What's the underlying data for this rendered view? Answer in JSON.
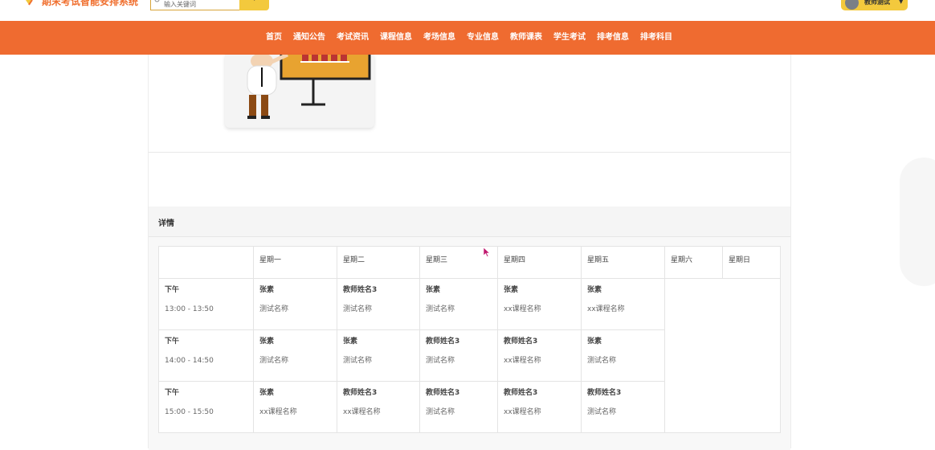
{
  "header": {
    "site_title": "期末考试智能安排系统",
    "search_placeholder": "输入关键词",
    "user_name": "教师测试"
  },
  "nav": {
    "items": [
      "首页",
      "通知公告",
      "考试资讯",
      "课程信息",
      "考场信息",
      "专业信息",
      "教师课表",
      "学生考试",
      "排考信息",
      "排考科目"
    ]
  },
  "detail": {
    "title": "详情",
    "columns": [
      "",
      "星期一",
      "星期二",
      "星期三",
      "星期四",
      "星期五",
      "星期六",
      "星期日"
    ],
    "rows": [
      {
        "period": "下午",
        "time": "13:00 - 13:50",
        "cells": [
          {
            "teacher": "张素",
            "course": "测试名称"
          },
          {
            "teacher": "教师姓名3",
            "course": "测试名称"
          },
          {
            "teacher": "张素",
            "course": "测试名称"
          },
          {
            "teacher": "张素",
            "course": "xx课程名称"
          },
          {
            "teacher": "张素",
            "course": "xx课程名称"
          }
        ]
      },
      {
        "period": "下午",
        "time": "14:00 - 14:50",
        "cells": [
          {
            "teacher": "张素",
            "course": "测试名称"
          },
          {
            "teacher": "张素",
            "course": "测试名称"
          },
          {
            "teacher": "教师姓名3",
            "course": "测试名称"
          },
          {
            "teacher": "教师姓名3",
            "course": "xx课程名称"
          },
          {
            "teacher": "张素",
            "course": "测试名称"
          }
        ]
      },
      {
        "period": "下午",
        "time": "15:00 - 15:50",
        "cells": [
          {
            "teacher": "张素",
            "course": "xx课程名称"
          },
          {
            "teacher": "教师姓名3",
            "course": "xx课程名称"
          },
          {
            "teacher": "教师姓名3",
            "course": "测试名称"
          },
          {
            "teacher": "教师姓名3",
            "course": "xx课程名称"
          },
          {
            "teacher": "教师姓名3",
            "course": "测试名称"
          }
        ]
      }
    ]
  },
  "colors": {
    "nav_bg": "#ef6b30",
    "accent_yellow": "#f3c93d",
    "title_orange": "#f07030"
  }
}
